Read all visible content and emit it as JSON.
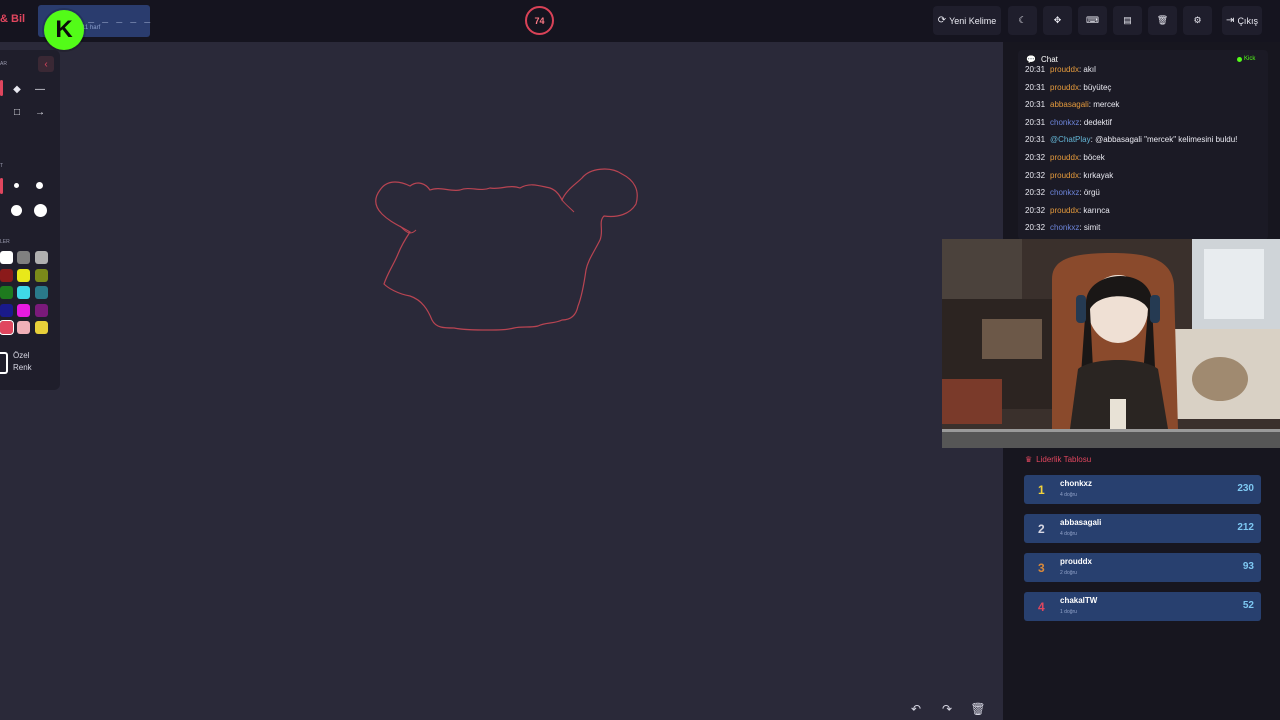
{
  "header": {
    "brand_text": "& Bil",
    "word_hint": "_ _ _ _ _ _ _ _",
    "word_letter_count": "11 harf",
    "kick_badge": "K",
    "timer": "74",
    "buttons": {
      "new_word": "Yeni Kelime",
      "logout": "Çıkış"
    },
    "icons": [
      "refresh-icon",
      "moon-icon",
      "crosshair-icon",
      "keyboard-icon",
      "box-icon",
      "trash-icon",
      "gear-icon",
      "logout-icon"
    ]
  },
  "tools": {
    "section1_label": "AR",
    "section2_label": "T",
    "section3_label": "LER",
    "collapse_icon": "‹",
    "custom_color_label_1": "Özel",
    "custom_color_label_2": "Renk",
    "colors": [
      "#ffffff",
      "#808080",
      "#b0b0b0",
      "#8b1a1a",
      "#e8e81a",
      "#7a8a1a",
      "#1e7a1e",
      "#3fd8e8",
      "#2a7a8a",
      "#1a1a8b",
      "#e81ae0",
      "#7a1a7a",
      "#e0465e",
      "#f0b0b8",
      "#e8d03a"
    ],
    "selected_color": "#e0465e"
  },
  "chat": {
    "title": "Chat",
    "source": "Kick",
    "messages": [
      {
        "time": "20:31",
        "user": "prouddx",
        "text": "akıl",
        "color": "orange"
      },
      {
        "time": "20:31",
        "user": "prouddx",
        "text": "büyüteç",
        "color": "orange"
      },
      {
        "time": "20:31",
        "user": "abbasagali",
        "text": "mercek",
        "color": "orange"
      },
      {
        "time": "20:31",
        "user": "chonkxz",
        "text": "dedektif",
        "color": "blue"
      },
      {
        "time": "20:31",
        "user": "@ChatPlay",
        "text": "@abbasagali \"mercek\" kelimesini buldu!",
        "color": "cyan"
      },
      {
        "time": "20:32",
        "user": "prouddx",
        "text": "böcek",
        "color": "orange"
      },
      {
        "time": "20:32",
        "user": "prouddx",
        "text": "kırkayak",
        "color": "orange"
      },
      {
        "time": "20:32",
        "user": "chonkxz",
        "text": "örgü",
        "color": "blue"
      },
      {
        "time": "20:32",
        "user": "prouddx",
        "text": "karınca",
        "color": "orange"
      },
      {
        "time": "20:32",
        "user": "chonkxz",
        "text": "simit",
        "color": "blue"
      }
    ]
  },
  "leaderboard": {
    "title": "Liderlik Tablosu",
    "rows": [
      {
        "rank": "1",
        "name": "chonkxz",
        "sub": "4 doğru",
        "score": "230",
        "rank_color": "#f2d23a"
      },
      {
        "rank": "2",
        "name": "abbasagali",
        "sub": "4 doğru",
        "score": "212",
        "rank_color": "#d8d8e4"
      },
      {
        "rank": "3",
        "name": "prouddx",
        "sub": "2 doğru",
        "score": "93",
        "rank_color": "#d9893a"
      },
      {
        "rank": "4",
        "name": "chakalTW",
        "sub": "1 doğru",
        "score": "52",
        "rank_color": "#e0465e"
      }
    ]
  },
  "canvas_controls": {
    "icons": [
      "undo-icon",
      "redo-icon",
      "clear-canvas-icon"
    ]
  }
}
